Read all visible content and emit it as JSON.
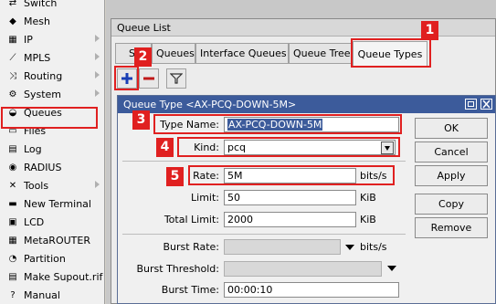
{
  "sidebar": {
    "items": [
      {
        "label": "Switch",
        "icon": "switch-icon"
      },
      {
        "label": "Mesh",
        "icon": "mesh-icon"
      },
      {
        "label": "IP",
        "icon": "ip-icon",
        "submenu": true
      },
      {
        "label": "MPLS",
        "icon": "mpls-icon",
        "submenu": true
      },
      {
        "label": "Routing",
        "icon": "routing-icon",
        "submenu": true
      },
      {
        "label": "System",
        "icon": "system-icon",
        "submenu": true
      },
      {
        "label": "Queues",
        "icon": "queues-icon"
      },
      {
        "label": "Files",
        "icon": "files-icon"
      },
      {
        "label": "Log",
        "icon": "log-icon"
      },
      {
        "label": "RADIUS",
        "icon": "radius-icon"
      },
      {
        "label": "Tools",
        "icon": "tools-icon",
        "submenu": true
      },
      {
        "label": "New Terminal",
        "icon": "terminal-icon"
      },
      {
        "label": "LCD",
        "icon": "lcd-icon"
      },
      {
        "label": "MetaROUTER",
        "icon": "metarouter-icon"
      },
      {
        "label": "Partition",
        "icon": "partition-icon"
      },
      {
        "label": "Make Supout.rif",
        "icon": "supout-icon"
      },
      {
        "label": "Manual",
        "icon": "manual-icon"
      }
    ]
  },
  "queue_list": {
    "title": "Queue List",
    "tabs": [
      {
        "label": "Simple Queues",
        "visible": "Si"
      },
      {
        "label": "Queues",
        "visible": "Queues"
      },
      {
        "label": "Interface Queues"
      },
      {
        "label": "Queue Tree"
      },
      {
        "label": "Queue Types",
        "active": true
      }
    ]
  },
  "dialog": {
    "title": "Queue Type <AX-PCQ-DOWN-5M>",
    "fields": {
      "type_name": {
        "label": "Type Name:",
        "value": "AX-PCQ-DOWN-5M"
      },
      "kind": {
        "label": "Kind:",
        "value": "pcq"
      },
      "rate": {
        "label": "Rate:",
        "value": "5M",
        "unit": "bits/s"
      },
      "limit": {
        "label": "Limit:",
        "value": "50",
        "unit": "KiB"
      },
      "total_limit": {
        "label": "Total Limit:",
        "value": "2000",
        "unit": "KiB"
      },
      "burst_rate": {
        "label": "Burst Rate:",
        "value": "",
        "unit": "bits/s"
      },
      "burst_threshold": {
        "label": "Burst Threshold:",
        "value": ""
      },
      "burst_time": {
        "label": "Burst Time:",
        "value": "00:00:10"
      }
    },
    "buttons": {
      "ok": "OK",
      "cancel": "Cancel",
      "apply": "Apply",
      "copy": "Copy",
      "remove": "Remove"
    }
  },
  "annotations": {
    "labels": [
      "1",
      "2",
      "3",
      "4",
      "5"
    ],
    "color": "#e02020"
  },
  "colors": {
    "title_bar": "#3c5b9b",
    "highlight": "#e02020"
  }
}
